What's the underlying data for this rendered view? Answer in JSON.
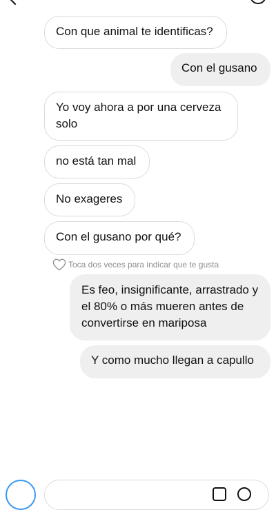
{
  "conversation": {
    "messages": [
      {
        "direction": "incoming",
        "text": "Con que animal te identificas?"
      },
      {
        "direction": "outgoing",
        "text": "Con el gusano"
      },
      {
        "direction": "incoming",
        "text": "Yo voy ahora a por una cerveza solo"
      },
      {
        "direction": "incoming",
        "text": "no está tan mal"
      },
      {
        "direction": "incoming",
        "text": "No exageres"
      },
      {
        "direction": "incoming",
        "text": "Con el gusano por qué?"
      },
      {
        "direction": "outgoing",
        "text": "Es feo, insignificante, arrastrado y el 80% o más mueren antes de convertirse en mariposa"
      },
      {
        "direction": "outgoing",
        "text": "Y como mucho llegan a capullo"
      }
    ],
    "like_hint": "Toca dos veces para indicar que te gusta"
  },
  "icons": {
    "back": "chevron-left-icon",
    "info": "info-icon",
    "heart": "heart-outline-icon",
    "camera": "camera-icon",
    "gallery": "gallery-icon",
    "sticker": "sticker-icon"
  },
  "colors": {
    "incoming_border": "#dbdbdb",
    "outgoing_bg": "#efefef",
    "hint_text": "#8e8e8e",
    "accent": "#3897f0"
  }
}
